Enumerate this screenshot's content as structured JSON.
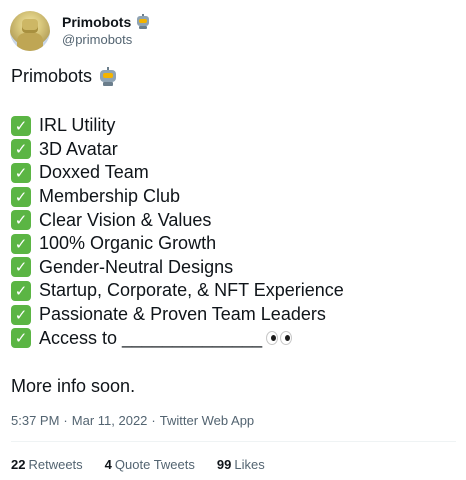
{
  "author": {
    "display_name": "Primobots",
    "handle": "@primobots",
    "name_emoji": "robot-face-emoji"
  },
  "tweet": {
    "title": "Primobots",
    "title_emoji": "robot-face-emoji",
    "items": [
      "IRL Utility",
      "3D Avatar",
      "Doxxed Team",
      "Membership Club",
      "Clear Vision & Values",
      "100% Organic Growth",
      "Gender-Neutral Designs",
      "Startup, Corporate, & NFT Experience",
      "Passionate & Proven Team Leaders",
      "Access to ______________"
    ],
    "item_emoji": "check-mark-button-emoji",
    "last_item_trailing_emoji": "eyes-emoji",
    "closing": "More info soon."
  },
  "meta": {
    "time": "5:37 PM",
    "separator": "·",
    "date": "Mar 11, 2022",
    "app": "Twitter Web App"
  },
  "stats": {
    "retweets_count": "22",
    "retweets_label": "Retweets",
    "quotes_count": "4",
    "quotes_label": "Quote Tweets",
    "likes_count": "99",
    "likes_label": "Likes"
  },
  "colors": {
    "text": "#0f1419",
    "secondary": "#536471",
    "check_green": "#5bb544",
    "divider": "#eff3f4"
  }
}
